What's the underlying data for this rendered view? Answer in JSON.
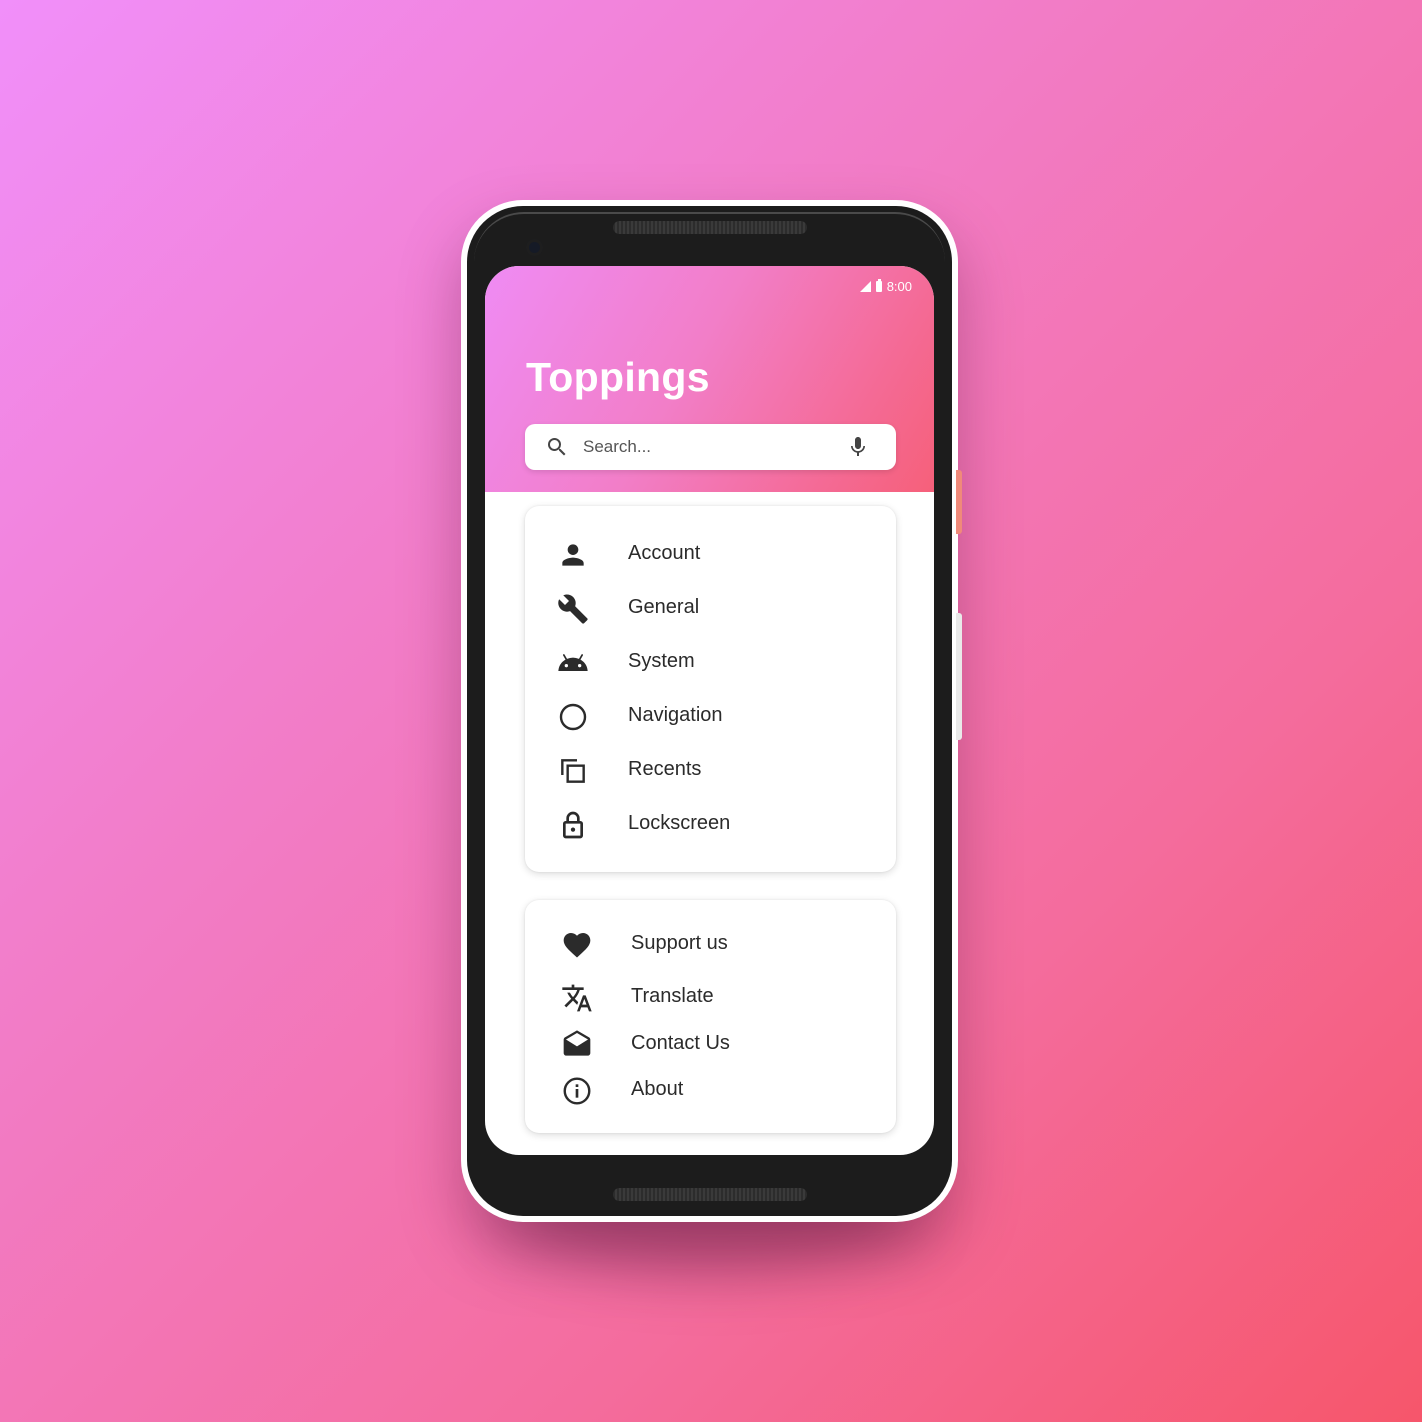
{
  "status_bar": {
    "time": "8:00",
    "signal_icon": "cell-signal-icon",
    "battery_icon": "battery-icon",
    "icon_color": "#ffffff"
  },
  "header": {
    "title": "Toppings",
    "gradient_colors": [
      "#ef8bf4",
      "#f27ec8",
      "#f46a95",
      "#f6607a"
    ]
  },
  "search": {
    "placeholder": "Search...",
    "value": "",
    "leading_icon": "search-icon",
    "trailing_icon": "microphone-icon"
  },
  "main_menu": [
    {
      "label": "Account",
      "icon": "person-icon"
    },
    {
      "label": "General",
      "icon": "wrench-icon"
    },
    {
      "label": "System",
      "icon": "android-icon"
    },
    {
      "label": "Navigation",
      "icon": "circle-icon"
    },
    {
      "label": "Recents",
      "icon": "copy-icon"
    },
    {
      "label": "Lockscreen",
      "icon": "lock-open-icon"
    }
  ],
  "secondary_menu": [
    {
      "label": "Support us",
      "icon": "heart-icon"
    },
    {
      "label": "Translate",
      "icon": "translate-icon"
    },
    {
      "label": "Contact Us",
      "icon": "open-envelope-icon"
    },
    {
      "label": "About",
      "icon": "info-icon"
    }
  ],
  "background_gradient": [
    "#f18ffa",
    "#f27dc9",
    "#f46c9d",
    "#f6566b"
  ],
  "text_color": "#2b2b2b"
}
